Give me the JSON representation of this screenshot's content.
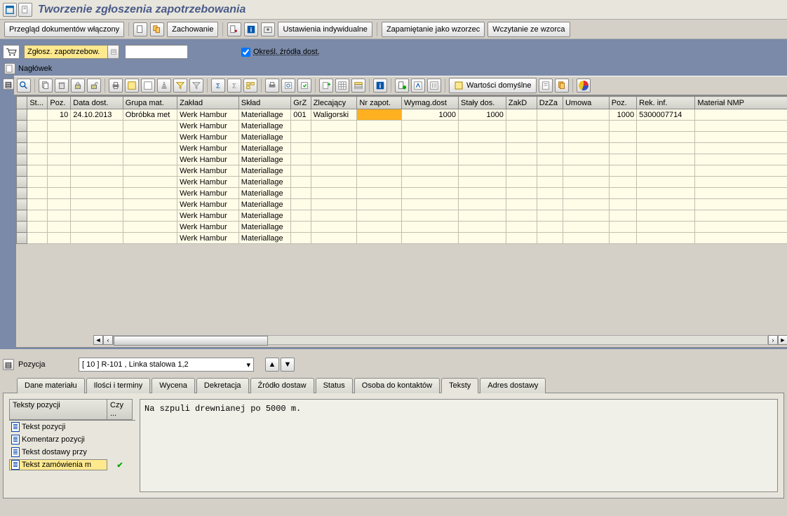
{
  "title": "Tworzenie zgłoszenia zapotrzebowania",
  "toolbar1": {
    "docview": "Przegląd dokumentów włączony",
    "save": "Zachowanie",
    "settings": "Ustawienia indywidualne",
    "save_template": "Zapamiętanie jako wzorzec",
    "load_template": "Wczytanie ze wzorca"
  },
  "doc": {
    "type_label": "Zgłosz. zapotrzebow.",
    "source_check": "Określ. źródła dost.",
    "header_label": "Nagłówek"
  },
  "toolbar2": {
    "defaults": "Wartości domyślne"
  },
  "grid": {
    "headers": [
      "",
      "St...",
      "Poz.",
      "Data dost.",
      "Grupa mat.",
      "Zakład",
      "Skład",
      "GrZ",
      "Zlecający",
      "Nr zapot.",
      "Wymag.dost",
      "Stały dos.",
      "ZakD",
      "DzZa",
      "Umowa",
      "Poz.",
      "Rek. inf.",
      "Materiał NMP"
    ],
    "widths": [
      14,
      26,
      30,
      68,
      70,
      80,
      68,
      26,
      60,
      58,
      74,
      62,
      40,
      34,
      60,
      36,
      76,
      120
    ],
    "rows": [
      {
        "cells": [
          "",
          "",
          "10",
          "24.10.2013",
          "Obróbka met",
          "Werk Hambur",
          "Materiallage",
          "001",
          "Waligorski",
          "",
          "1000",
          "1000",
          "",
          "",
          "",
          "1000",
          "5300007714",
          ""
        ],
        "highlight": 9
      },
      {
        "cells": [
          "",
          "",
          "",
          "",
          "",
          "Werk Hambur",
          "Materiallage",
          "",
          "",
          "",
          "",
          "",
          "",
          "",
          "",
          "",
          "",
          ""
        ]
      },
      {
        "cells": [
          "",
          "",
          "",
          "",
          "",
          "Werk Hambur",
          "Materiallage",
          "",
          "",
          "",
          "",
          "",
          "",
          "",
          "",
          "",
          "",
          ""
        ]
      },
      {
        "cells": [
          "",
          "",
          "",
          "",
          "",
          "Werk Hambur",
          "Materiallage",
          "",
          "",
          "",
          "",
          "",
          "",
          "",
          "",
          "",
          "",
          ""
        ]
      },
      {
        "cells": [
          "",
          "",
          "",
          "",
          "",
          "Werk Hambur",
          "Materiallage",
          "",
          "",
          "",
          "",
          "",
          "",
          "",
          "",
          "",
          "",
          ""
        ]
      },
      {
        "cells": [
          "",
          "",
          "",
          "",
          "",
          "Werk Hambur",
          "Materiallage",
          "",
          "",
          "",
          "",
          "",
          "",
          "",
          "",
          "",
          "",
          ""
        ]
      },
      {
        "cells": [
          "",
          "",
          "",
          "",
          "",
          "Werk Hambur",
          "Materiallage",
          "",
          "",
          "",
          "",
          "",
          "",
          "",
          "",
          "",
          "",
          ""
        ]
      },
      {
        "cells": [
          "",
          "",
          "",
          "",
          "",
          "Werk Hambur",
          "Materiallage",
          "",
          "",
          "",
          "",
          "",
          "",
          "",
          "",
          "",
          "",
          ""
        ]
      },
      {
        "cells": [
          "",
          "",
          "",
          "",
          "",
          "Werk Hambur",
          "Materiallage",
          "",
          "",
          "",
          "",
          "",
          "",
          "",
          "",
          "",
          "",
          ""
        ]
      },
      {
        "cells": [
          "",
          "",
          "",
          "",
          "",
          "Werk Hambur",
          "Materiallage",
          "",
          "",
          "",
          "",
          "",
          "",
          "",
          "",
          "",
          "",
          ""
        ]
      },
      {
        "cells": [
          "",
          "",
          "",
          "",
          "",
          "Werk Hambur",
          "Materiallage",
          "",
          "",
          "",
          "",
          "",
          "",
          "",
          "",
          "",
          "",
          ""
        ]
      },
      {
        "cells": [
          "",
          "",
          "",
          "",
          "",
          "Werk Hambur",
          "Materiallage",
          "",
          "",
          "",
          "",
          "",
          "",
          "",
          "",
          "",
          "",
          ""
        ]
      }
    ]
  },
  "position": {
    "label": "Pozycja",
    "value": "[ 10 ] R-101 , Linka stalowa 1,2"
  },
  "tabs": [
    "Dane materiału",
    "Ilości i terminy",
    "Wycena",
    "Dekretacja",
    "Źródło dostaw",
    "Status",
    "Osoba do kontaktów",
    "Teksty",
    "Adres dostawy"
  ],
  "active_tab": 7,
  "textpanel": {
    "list_header1": "Teksty pozycji",
    "list_header2": "Czy ...",
    "items": [
      {
        "label": "Tekst pozycji",
        "check": false
      },
      {
        "label": "Komentarz pozycji",
        "check": false
      },
      {
        "label": "Tekst dostawy przy",
        "check": false
      },
      {
        "label": "Tekst zamówienia m",
        "check": true
      }
    ],
    "selected": 3,
    "content": "Na szpuli drewnianej po 5000 m."
  }
}
